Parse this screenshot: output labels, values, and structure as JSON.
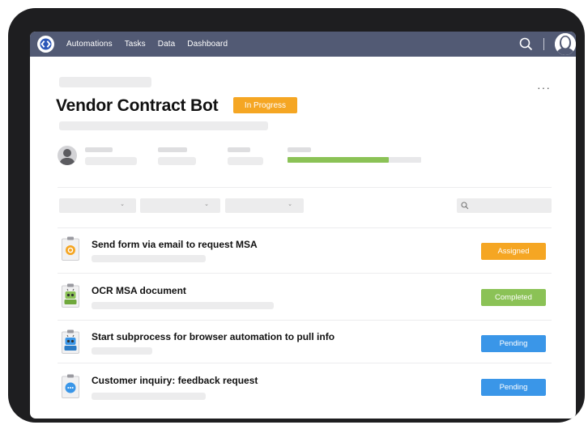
{
  "nav": {
    "items": [
      "Automations",
      "Tasks",
      "Data",
      "Dashboard"
    ]
  },
  "icons": {
    "logo": "logo-icon",
    "search": "search-icon",
    "user": "user-avatar-icon",
    "more": "more-horizontal-icon"
  },
  "header": {
    "title": "Vendor Contract Bot",
    "status": "In Progress",
    "more": "···"
  },
  "progress": {
    "fraction": 0.76,
    "color": "#8bc256"
  },
  "filters": {
    "chevron": "⌄",
    "search_icon": "search-icon"
  },
  "tasks": [
    {
      "title": "Send form via email to request MSA",
      "status": "Assigned",
      "status_color": "#f5a623",
      "icon": "email-form-icon"
    },
    {
      "title": "OCR MSA document",
      "status": "Completed",
      "status_color": "#8bc256",
      "icon": "robot-green-icon"
    },
    {
      "title": "Start subprocess for browser automation to pull info",
      "status": "Pending",
      "status_color": "#3a96e8",
      "icon": "robot-blue-icon"
    },
    {
      "title": "Customer inquiry: feedback request",
      "status": "Pending",
      "status_color": "#3a96e8",
      "icon": "chat-bubble-icon"
    }
  ],
  "colors": {
    "topbar": "#525a74",
    "in_progress": "#f5a623",
    "assigned": "#f5a623",
    "completed": "#8bc256",
    "pending": "#3a96e8"
  }
}
